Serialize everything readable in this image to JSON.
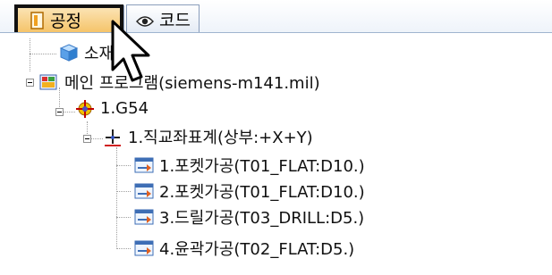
{
  "tabs": [
    {
      "label": "공정",
      "icon": "process-doc-icon",
      "active": true
    },
    {
      "label": "코드",
      "icon": "eye-icon",
      "active": false
    }
  ],
  "tree": {
    "material": {
      "label": "소재"
    },
    "main_program": {
      "label": "메인 프로그램(siemens-m141.mil)"
    },
    "g54": {
      "label": "1.G54"
    },
    "coordinate": {
      "label": "1.직교좌표계(상부:+X+Y)"
    },
    "operations": [
      {
        "label": "1.포켓가공(T01_FLAT:D10.)"
      },
      {
        "label": "2.포켓가공(T01_FLAT:D10.)"
      },
      {
        "label": "3.드릴가공(T03_DRILL:D5.)"
      },
      {
        "label": "4.윤곽가공(T02_FLAT:D5.)"
      }
    ]
  },
  "colors": {
    "active_tab": "#f5c46a",
    "highlight_border": "#111111",
    "tree_line": "#a0a0a0"
  }
}
